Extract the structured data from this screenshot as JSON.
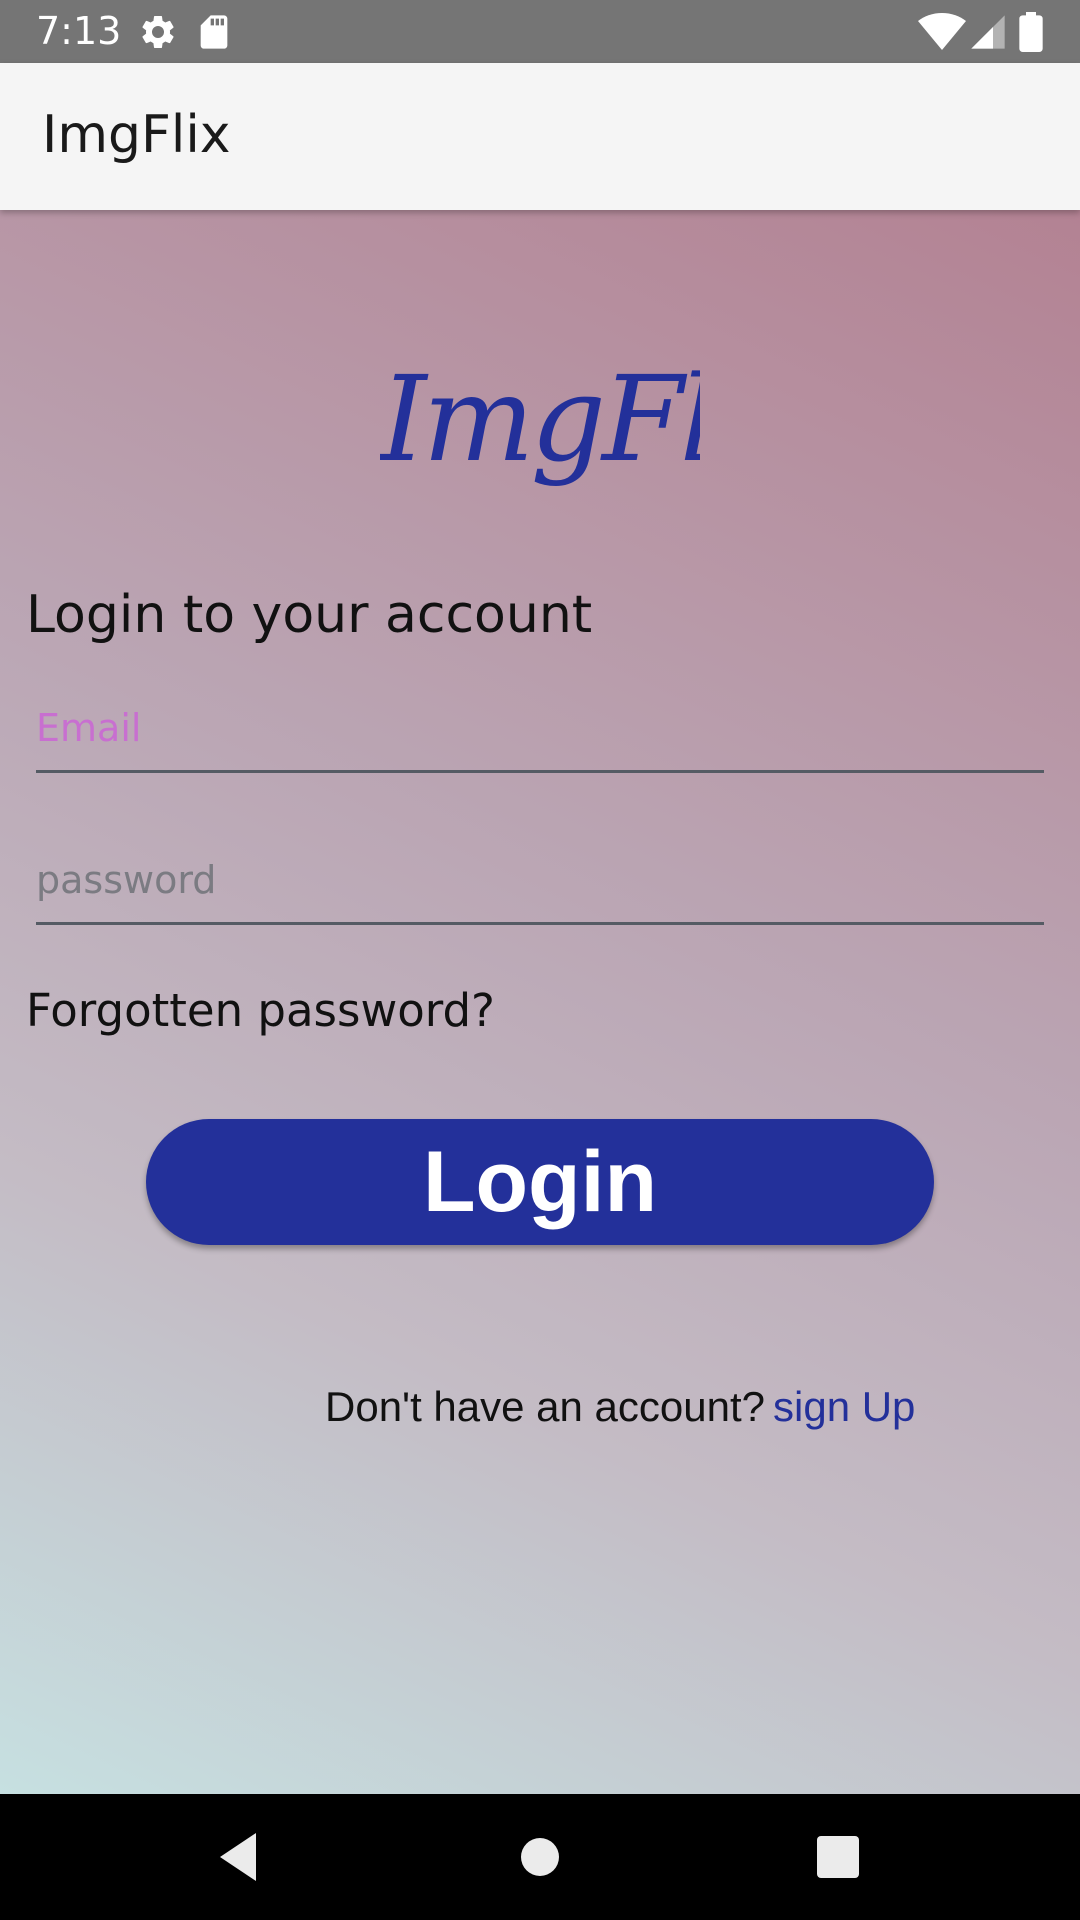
{
  "status_bar": {
    "time": "7:13",
    "left_icons": [
      "settings-gear",
      "sd-card"
    ],
    "right_icons": [
      "wifi-full",
      "cellular-signal",
      "battery-full"
    ]
  },
  "app_bar": {
    "title": "ImgFlix"
  },
  "logo": {
    "text": "ImgFlix",
    "color": "#23309a"
  },
  "login_form": {
    "heading": "Login to your account",
    "email": {
      "placeholder": "Email",
      "value": "",
      "placeholder_color": "#c86fd0"
    },
    "password": {
      "placeholder": "password",
      "value": ""
    },
    "forgot_password_label": "Forgotten password?",
    "login_button_label": "Login",
    "signup_prompt": "Don't have an account?",
    "signup_link_label": "sign Up"
  },
  "nav_bar": {
    "buttons": [
      "back",
      "home",
      "recents"
    ]
  },
  "colors": {
    "accent": "#23309a",
    "status_bar": "#757575",
    "app_bar": "#f5f5f5",
    "gradient_top": "#b38293",
    "gradient_bottom": "#c6e0e1"
  }
}
